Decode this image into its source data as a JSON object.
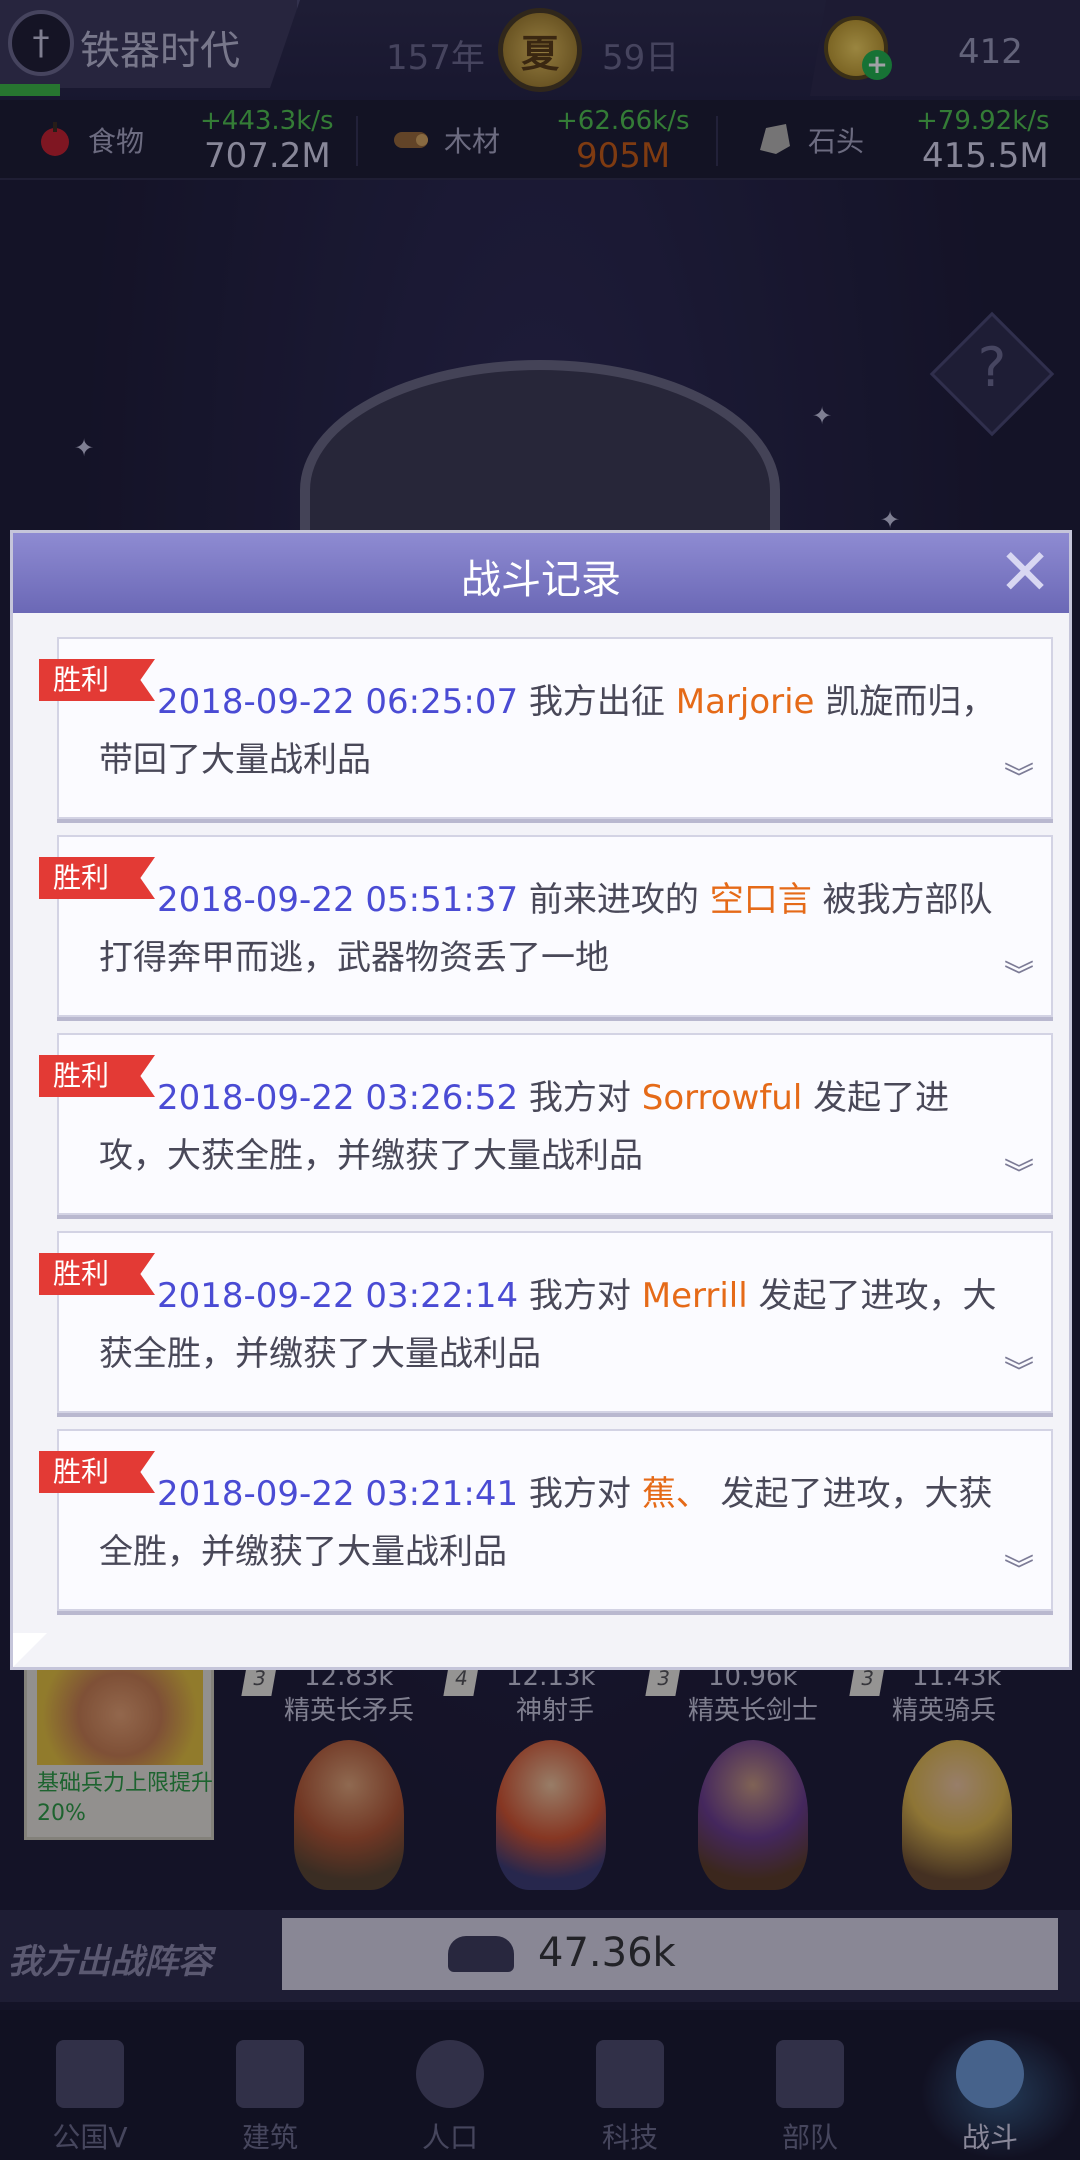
{
  "topbar": {
    "era_name": "铁器时代",
    "year": "157年",
    "season": "夏",
    "day": "59日",
    "gold": "412",
    "plus_symbol": "+"
  },
  "resources": [
    {
      "label": "食物",
      "rate": "+443.3k/s",
      "amount": "707.2M",
      "amount_color": "#d7d6ea",
      "icon": "food-icon"
    },
    {
      "label": "木材",
      "rate": "+62.66k/s",
      "amount": "905M",
      "amount_color": "#c85b10",
      "icon": "wood-icon"
    },
    {
      "label": "石头",
      "rate": "+79.92k/s",
      "amount": "415.5M",
      "amount_color": "#d7d6ea",
      "icon": "stone-icon"
    }
  ],
  "scene": {
    "help_symbol": "?"
  },
  "army": {
    "commander_bonus": "基础兵力上限提升20%",
    "units": [
      {
        "level": "3",
        "power": "12.83k",
        "name": "精英长矛兵"
      },
      {
        "level": "4",
        "power": "12.13k",
        "name": "神射手"
      },
      {
        "level": "3",
        "power": "10.96k",
        "name": "精英长剑士"
      },
      {
        "level": "3",
        "power": "11.43k",
        "name": "精英骑兵"
      }
    ],
    "lineup_label": "我方出战阵容",
    "lineup_value": "47.36k"
  },
  "nav": {
    "items": [
      {
        "label": "公国V",
        "icon": "castle-icon"
      },
      {
        "label": "建筑",
        "icon": "building-icon"
      },
      {
        "label": "人口",
        "icon": "population-icon"
      },
      {
        "label": "科技",
        "icon": "book-icon"
      },
      {
        "label": "部队",
        "icon": "banner-icon"
      },
      {
        "label": "战斗",
        "icon": "crossed-swords-icon"
      }
    ],
    "active": "战斗"
  },
  "modal": {
    "title": "战斗记录",
    "close_symbol": "✕",
    "expand_symbol": "︾",
    "records": [
      {
        "tag": "胜利",
        "timestamp": "2018-09-22 06:25:07",
        "pre": "我方出征",
        "opponent": "Marjorie",
        "post": "凯旋而归，带回了大量战利品"
      },
      {
        "tag": "胜利",
        "timestamp": "2018-09-22 05:51:37",
        "pre": "前来进攻的",
        "opponent": "空口言",
        "post": "被我方部队打得奔甲而逃，武器物资丢了一地"
      },
      {
        "tag": "胜利",
        "timestamp": "2018-09-22 03:26:52",
        "pre": "我方对",
        "opponent": "Sorrowful",
        "post": "发起了进攻，大获全胜，并缴获了大量战利品"
      },
      {
        "tag": "胜利",
        "timestamp": "2018-09-22 03:22:14",
        "pre": "我方对",
        "opponent": "Merrill",
        "post": "发起了进攻，大获全胜，并缴获了大量战利品"
      },
      {
        "tag": "胜利",
        "timestamp": "2018-09-22 03:21:41",
        "pre": "我方对",
        "opponent": "蕉、",
        "post": "发起了进攻，大获全胜，并缴获了大量战利品"
      }
    ]
  }
}
